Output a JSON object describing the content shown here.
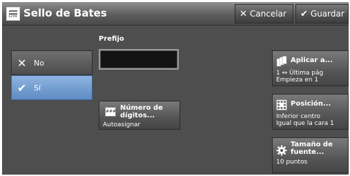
{
  "window": {
    "title": "Sello de Bates",
    "title_icon": "bates-stamp-icon"
  },
  "toolbar": {
    "cancel_label": "Cancelar",
    "cancel_icon": "x-icon",
    "save_label": "Guardar",
    "save_icon": "check-icon"
  },
  "options": [
    {
      "label": "No",
      "icon": "x-icon",
      "selected": false
    },
    {
      "label": "Sí",
      "icon": "check-icon",
      "selected": true
    }
  ],
  "prefix": {
    "label": "Prefijo",
    "value": ""
  },
  "digits": {
    "title": "Número de dígitos...",
    "value": "Autoasignar",
    "icon": "digits-icon"
  },
  "apply": {
    "title": "Aplicar a...",
    "line1": "1 ↔ Última pág",
    "line2": "Empieza en 1",
    "icon": "pages-icon"
  },
  "position": {
    "title": "Posición...",
    "line1": "Inferior centro",
    "line2": "Igual que la cara 1",
    "icon": "position-grid-icon"
  },
  "fontsize": {
    "title": "Tamaño de fuente...",
    "line1": "10 puntos",
    "icon": "gear-icon"
  },
  "colors": {
    "background": "#4e4e4e",
    "selected": "#6f9ad0",
    "input": "#141414"
  }
}
